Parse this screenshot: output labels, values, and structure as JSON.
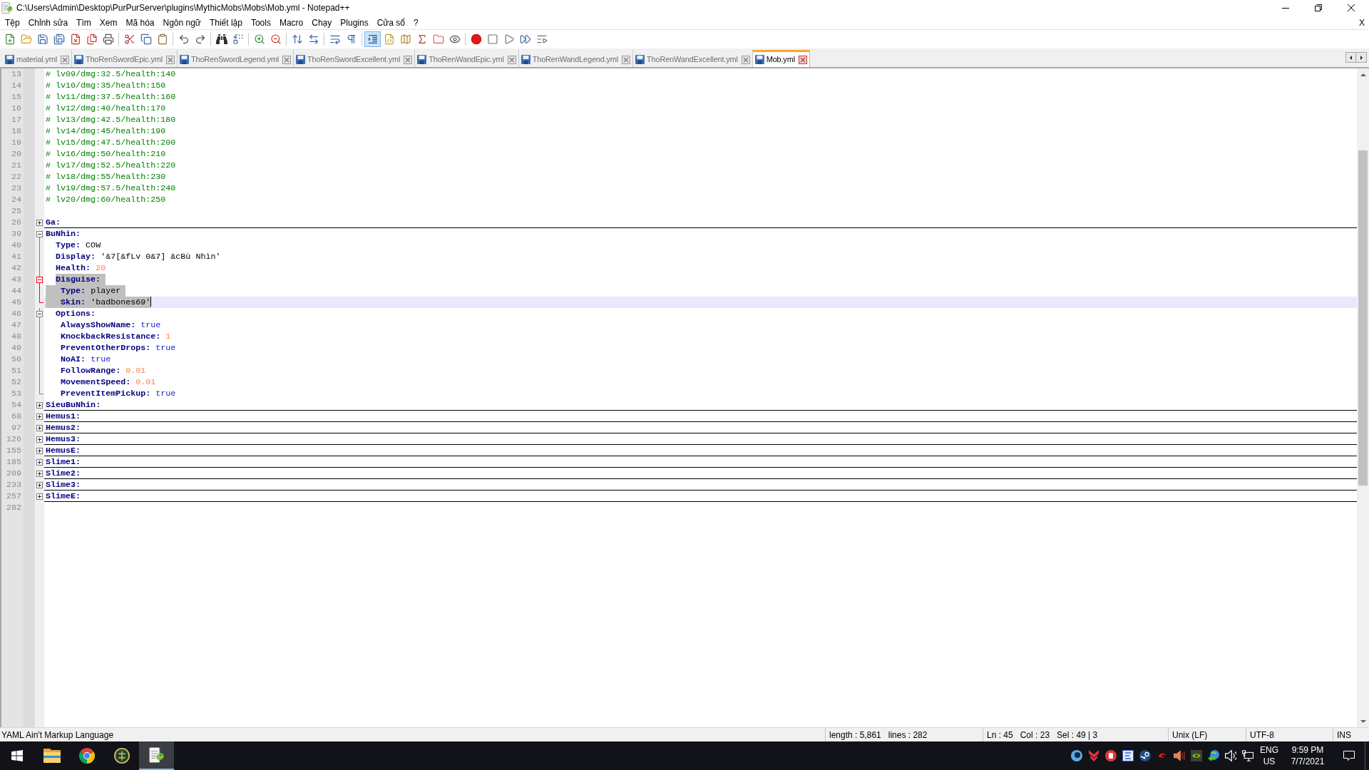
{
  "window": {
    "title": "C:\\Users\\Admin\\Desktop\\PurPurServer\\plugins\\MythicMobs\\Mobs\\Mob.yml - Notepad++"
  },
  "menu": {
    "items": [
      "Tệp",
      "Chỉnh sửa",
      "Tìm",
      "Xem",
      "Mã hóa",
      "Ngôn ngữ",
      "Thiết lập",
      "Tools",
      "Macro",
      "Chạy",
      "Plugins",
      "Cửa sổ",
      "?"
    ],
    "close": "X"
  },
  "toolbar": {
    "groups": [
      [
        {
          "kind": "new",
          "pressed": false
        },
        {
          "kind": "open",
          "pressed": false
        },
        {
          "kind": "save",
          "pressed": false
        },
        {
          "kind": "save_all",
          "pressed": false
        },
        {
          "kind": "close",
          "pressed": false
        },
        {
          "kind": "close_all",
          "pressed": false
        },
        {
          "kind": "print",
          "pressed": false
        }
      ],
      [
        {
          "kind": "cut",
          "pressed": false
        },
        {
          "kind": "copy",
          "pressed": false
        },
        {
          "kind": "paste",
          "pressed": false
        }
      ],
      [
        {
          "kind": "undo",
          "pressed": false
        },
        {
          "kind": "redo",
          "pressed": false
        }
      ],
      [
        {
          "kind": "find",
          "pressed": false
        },
        {
          "kind": "replace",
          "pressed": false
        }
      ],
      [
        {
          "kind": "zoom_in",
          "pressed": false
        },
        {
          "kind": "zoom_out",
          "pressed": false
        }
      ],
      [
        {
          "kind": "sync_v",
          "pressed": false
        },
        {
          "kind": "sync_h",
          "pressed": false
        }
      ],
      [
        {
          "kind": "wrap",
          "pressed": false
        },
        {
          "kind": "all_chars",
          "pressed": false
        }
      ],
      [
        {
          "kind": "indent_guide",
          "pressed": true
        },
        {
          "kind": "udl",
          "pressed": false
        },
        {
          "kind": "doc_map",
          "pressed": false
        },
        {
          "kind": "func_list",
          "pressed": false
        },
        {
          "kind": "folder_ws",
          "pressed": false
        },
        {
          "kind": "monitor",
          "pressed": false
        }
      ],
      [
        {
          "kind": "record",
          "pressed": false
        },
        {
          "kind": "stop",
          "pressed": false
        },
        {
          "kind": "play",
          "pressed": false
        },
        {
          "kind": "play_multi",
          "pressed": false
        },
        {
          "kind": "save_macro",
          "pressed": false
        }
      ]
    ]
  },
  "tabs": [
    {
      "label": "material.yml",
      "selected": false
    },
    {
      "label": "ThoRenSwordEpic.yml",
      "selected": false
    },
    {
      "label": "ThoRenSwordLegend.yml",
      "selected": false
    },
    {
      "label": "ThoRenSwordExcellent.yml",
      "selected": false
    },
    {
      "label": "ThoRenWandEpic.yml",
      "selected": false
    },
    {
      "label": "ThoRenWandLegend.yml",
      "selected": false
    },
    {
      "label": "ThoRenWandExcellent.yml",
      "selected": false
    },
    {
      "label": "Mob.yml",
      "selected": true
    }
  ],
  "editor": {
    "lines": [
      {
        "number": "13",
        "selected": false,
        "current": false,
        "segments": [
          {
            "kind": "comment",
            "text": "# lv09/dmg:32.5/health:140"
          }
        ]
      },
      {
        "number": "14",
        "selected": false,
        "current": false,
        "segments": [
          {
            "kind": "comment",
            "text": "# lv10/dmg:35/health:150"
          }
        ]
      },
      {
        "number": "15",
        "selected": false,
        "current": false,
        "segments": [
          {
            "kind": "comment",
            "text": "# lv11/dmg:37.5/health:160"
          }
        ]
      },
      {
        "number": "16",
        "selected": false,
        "current": false,
        "segments": [
          {
            "kind": "comment",
            "text": "# lv12/dmg:40/health:170"
          }
        ]
      },
      {
        "number": "17",
        "selected": false,
        "current": false,
        "segments": [
          {
            "kind": "comment",
            "text": "# lv13/dmg:42.5/health:180"
          }
        ]
      },
      {
        "number": "18",
        "selected": false,
        "current": false,
        "segments": [
          {
            "kind": "comment",
            "text": "# lv14/dmg:45/health:190"
          }
        ]
      },
      {
        "number": "19",
        "selected": false,
        "current": false,
        "segments": [
          {
            "kind": "comment",
            "text": "# lv15/dmg:47.5/health:200"
          }
        ]
      },
      {
        "number": "20",
        "selected": false,
        "current": false,
        "segments": [
          {
            "kind": "comment",
            "text": "# lv16/dmg:50/health:210"
          }
        ]
      },
      {
        "number": "21",
        "selected": false,
        "current": false,
        "segments": [
          {
            "kind": "comment",
            "text": "# lv17/dmg:52.5/health:220"
          }
        ]
      },
      {
        "number": "22",
        "selected": false,
        "current": false,
        "segments": [
          {
            "kind": "comment",
            "text": "# lv18/dmg:55/health:230"
          }
        ]
      },
      {
        "number": "23",
        "selected": false,
        "current": false,
        "segments": [
          {
            "kind": "comment",
            "text": "# lv19/dmg:57.5/health:240"
          }
        ]
      },
      {
        "number": "24",
        "selected": false,
        "current": false,
        "segments": [
          {
            "kind": "comment",
            "text": "# lv20/dmg:60/health:250"
          }
        ]
      },
      {
        "number": "25",
        "selected": false,
        "current": false
      },
      {
        "number": "26",
        "selected": false,
        "current": false,
        "expanded": false,
        "fold_active": false,
        "segments": [
          {
            "kind": "key",
            "text": "Ga:"
          }
        ]
      },
      {
        "number": "39",
        "selected": false,
        "current": false,
        "expanded": true,
        "fold_active": false,
        "segments": [
          {
            "kind": "key",
            "text": "BuNhin:"
          }
        ],
        "children": [
          {
            "number": "40",
            "selected": false,
            "current": false,
            "segments": [
              {
                "kind": "key",
                "text": "Type:"
              },
              {
                "kind": "text",
                "text": "COW"
              }
            ]
          },
          {
            "number": "41",
            "selected": false,
            "current": false,
            "segments": [
              {
                "kind": "key",
                "text": "Display:"
              },
              {
                "kind": "text",
                "text": "'&7[&fLv 0&7] &cBù Nhìn'"
              }
            ]
          },
          {
            "number": "42",
            "selected": false,
            "current": false,
            "segments": [
              {
                "kind": "key",
                "text": "Health:"
              },
              {
                "kind": "number",
                "text": "20"
              }
            ]
          },
          {
            "number": "43",
            "selected": true,
            "current": false,
            "expanded": true,
            "fold_active": true,
            "segments": [
              {
                "kind": "key",
                "text": "Disguise:"
              }
            ],
            "children": [
              {
                "number": "44",
                "selected": true,
                "current": false,
                "segments": [
                  {
                    "kind": "key",
                    "text": "Type:"
                  },
                  {
                    "kind": "text",
                    "text": "player"
                  }
                ]
              },
              {
                "number": "45",
                "selected": true,
                "current": true,
                "segments": [
                  {
                    "kind": "key",
                    "text": "Skin:"
                  },
                  {
                    "kind": "text",
                    "text": "'badbones69'"
                  }
                ]
              }
            ]
          },
          {
            "number": "46",
            "selected": false,
            "current": false,
            "expanded": true,
            "fold_active": false,
            "segments": [
              {
                "kind": "key",
                "text": "Options:"
              }
            ],
            "children": [
              {
                "number": "47",
                "selected": false,
                "current": false,
                "segments": [
                  {
                    "kind": "key",
                    "text": "AlwaysShowName:"
                  },
                  {
                    "kind": "boolean",
                    "text": "true"
                  }
                ]
              },
              {
                "number": "48",
                "selected": false,
                "current": false,
                "segments": [
                  {
                    "kind": "key",
                    "text": "KnockbackResistance:"
                  },
                  {
                    "kind": "number",
                    "text": "1"
                  }
                ]
              },
              {
                "number": "49",
                "selected": false,
                "current": false,
                "segments": [
                  {
                    "kind": "key",
                    "text": "PreventOtherDrops:"
                  },
                  {
                    "kind": "boolean",
                    "text": "true"
                  }
                ]
              },
              {
                "number": "50",
                "selected": false,
                "current": false,
                "segments": [
                  {
                    "kind": "key",
                    "text": "NoAI:"
                  },
                  {
                    "kind": "boolean",
                    "text": "true"
                  }
                ]
              },
              {
                "number": "51",
                "selected": false,
                "current": false,
                "segments": [
                  {
                    "kind": "key",
                    "text": "FollowRange:"
                  },
                  {
                    "kind": "number",
                    "text": "0.01"
                  }
                ]
              },
              {
                "number": "52",
                "selected": false,
                "current": false,
                "segments": [
                  {
                    "kind": "key",
                    "text": "MovementSpeed:"
                  },
                  {
                    "kind": "number",
                    "text": "0.01"
                  }
                ]
              },
              {
                "number": "53",
                "selected": false,
                "current": false,
                "segments": [
                  {
                    "kind": "key",
                    "text": "PreventItemPickup:"
                  },
                  {
                    "kind": "boolean",
                    "text": "true"
                  }
                ]
              }
            ]
          }
        ]
      },
      {
        "number": "54",
        "selected": false,
        "current": false,
        "expanded": false,
        "fold_active": false,
        "segments": [
          {
            "kind": "key",
            "text": "SieuBuNhin:"
          }
        ]
      },
      {
        "number": "68",
        "selected": false,
        "current": false,
        "expanded": false,
        "fold_active": false,
        "segments": [
          {
            "kind": "key",
            "text": "Hemus1:"
          }
        ]
      },
      {
        "number": "97",
        "selected": false,
        "current": false,
        "expanded": false,
        "fold_active": false,
        "segments": [
          {
            "kind": "key",
            "text": "Hemus2:"
          }
        ]
      },
      {
        "number": "126",
        "selected": false,
        "current": false,
        "expanded": false,
        "fold_active": false,
        "segments": [
          {
            "kind": "key",
            "text": "Hemus3:"
          }
        ]
      },
      {
        "number": "155",
        "selected": false,
        "current": false,
        "expanded": false,
        "fold_active": false,
        "segments": [
          {
            "kind": "key",
            "text": "HemusE:"
          }
        ]
      },
      {
        "number": "185",
        "selected": false,
        "current": false,
        "expanded": false,
        "fold_active": false,
        "segments": [
          {
            "kind": "key",
            "text": "Slime1:"
          }
        ]
      },
      {
        "number": "209",
        "selected": false,
        "current": false,
        "expanded": false,
        "fold_active": false,
        "segments": [
          {
            "kind": "key",
            "text": "Slime2:"
          }
        ]
      },
      {
        "number": "233",
        "selected": false,
        "current": false,
        "expanded": false,
        "fold_active": false,
        "segments": [
          {
            "kind": "key",
            "text": "Slime3:"
          }
        ]
      },
      {
        "number": "257",
        "selected": false,
        "current": false,
        "expanded": false,
        "fold_active": false,
        "segments": [
          {
            "kind": "key",
            "text": "SlimeE:"
          }
        ]
      },
      {
        "number": "282",
        "selected": false,
        "current": false
      }
    ]
  },
  "status_bar": {
    "language": "YAML Ain't Markup Language",
    "length": "length : 5,861",
    "lines": "lines : 282",
    "ln": "Ln : 45",
    "col": "Col : 23",
    "sel": "Sel : 49 | 3",
    "eol": "Unix (LF)",
    "encoding": "UTF-8",
    "mode": "INS"
  },
  "taskbar": {
    "apps": [
      {
        "kind": "explorer",
        "active": false
      },
      {
        "kind": "browser",
        "active": false
      },
      {
        "kind": "circle_app",
        "active": false
      },
      {
        "kind": "notepad",
        "active": true
      }
    ],
    "language": {
      "code": "ENG",
      "region": "US"
    },
    "clock": {
      "time": "9:59 PM",
      "date": "7/7/2021"
    }
  }
}
